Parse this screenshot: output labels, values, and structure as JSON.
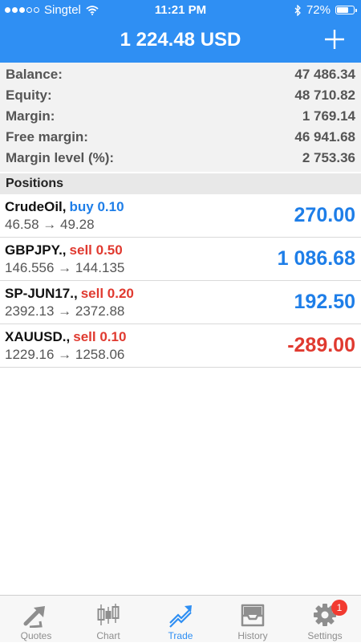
{
  "status_bar": {
    "carrier": "Singtel",
    "time": "11:21 PM",
    "battery_percent": "72%",
    "battery_level": 0.72,
    "signal_bars_filled": 3,
    "signal_bars_total": 5
  },
  "header": {
    "title": "1 224.48 USD",
    "add_icon": "plus-icon"
  },
  "summary": {
    "rows": [
      {
        "label": "Balance:",
        "value": "47 486.34"
      },
      {
        "label": "Equity:",
        "value": "48 710.82"
      },
      {
        "label": "Margin:",
        "value": "1 769.14"
      },
      {
        "label": "Free margin:",
        "value": "46 941.68"
      },
      {
        "label": "Margin level (%):",
        "value": "2 753.36"
      }
    ]
  },
  "positions": {
    "title": "Positions",
    "items": [
      {
        "symbol": "CrudeOil,",
        "action": "buy 0.10",
        "prices": "46.58 → 49.28",
        "profit": "270.00"
      },
      {
        "symbol": "GBPJPY.,",
        "action": "sell 0.50",
        "prices": "146.556 → 144.135",
        "profit": "1 086.68"
      },
      {
        "symbol": "SP-JUN17.,",
        "action": "sell 0.20",
        "prices": "2392.13 → 2372.88",
        "profit": "192.50"
      },
      {
        "symbol": "XAUUSD.,",
        "action": "sell 0.10",
        "prices": "1229.16 → 1258.06",
        "profit": "-289.00"
      }
    ]
  },
  "tabbar": {
    "tabs": [
      {
        "label": "Quotes",
        "icon": "quotes-icon"
      },
      {
        "label": "Chart",
        "icon": "candlestick-chart-icon"
      },
      {
        "label": "Trade",
        "icon": "trade-icon",
        "active": true
      },
      {
        "label": "History",
        "icon": "inbox-history-icon"
      },
      {
        "label": "Settings",
        "icon": "gear-icon",
        "badge": "1"
      }
    ]
  },
  "colors": {
    "accent": "#2f8ff3",
    "profit_positive": "#1e7ee8",
    "profit_negative": "#e03a30",
    "badge": "#f23a30"
  }
}
